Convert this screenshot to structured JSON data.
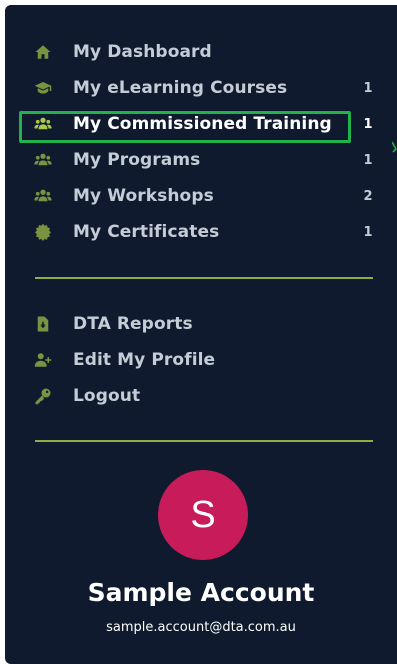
{
  "nav_primary": [
    {
      "label": "My Dashboard",
      "icon": "home-icon",
      "count": ""
    },
    {
      "label": "My eLearning Courses",
      "icon": "graduation-cap-icon",
      "count": "1"
    },
    {
      "label": "My Commissioned Training",
      "icon": "users-icon",
      "count": "1",
      "active": true
    },
    {
      "label": "My Programs",
      "icon": "users-icon",
      "count": "1"
    },
    {
      "label": "My Workshops",
      "icon": "users-icon",
      "count": "2"
    },
    {
      "label": "My Certificates",
      "icon": "certificate-icon",
      "count": "1"
    }
  ],
  "nav_secondary": [
    {
      "label": "DTA Reports",
      "icon": "file-download-icon"
    },
    {
      "label": "Edit My Profile",
      "icon": "user-plus-icon"
    },
    {
      "label": "Logout",
      "icon": "key-icon"
    }
  ],
  "account": {
    "initial": "S",
    "name": "Sample Account",
    "email": "sample.account@dta.com.au",
    "avatar_color": "#c81c5a"
  },
  "colors": {
    "panel_bg": "#0f1a2e",
    "icon_accent": "#7a9340",
    "divider": "#a8c84b",
    "highlight": "#22b24c"
  }
}
